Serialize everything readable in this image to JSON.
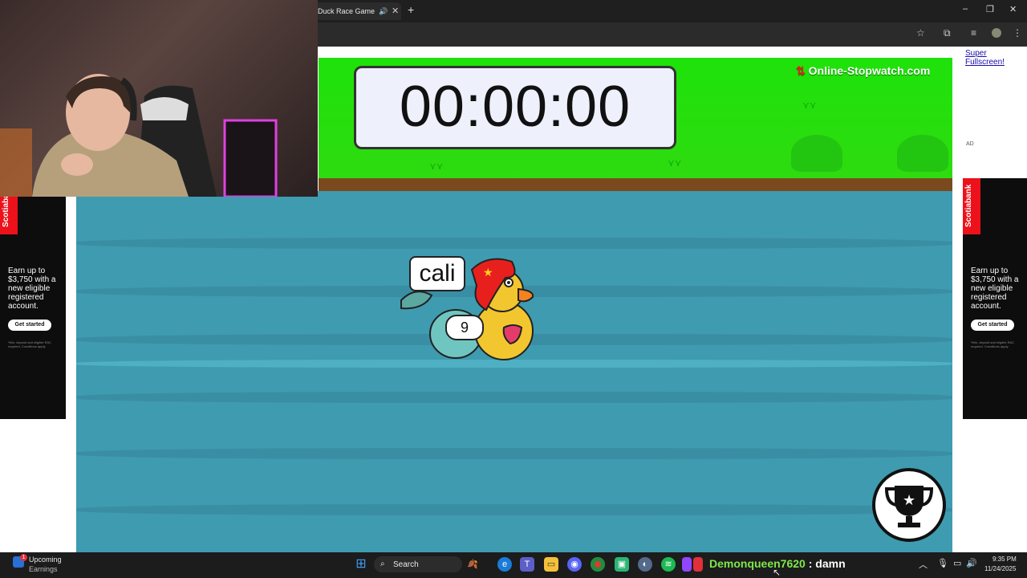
{
  "browser": {
    "tab_title": "Duck Race Game",
    "tab_sound_icon": "speaker-icon",
    "new_tab_symbol": "+",
    "window_controls": [
      "–",
      "❐",
      "✕"
    ]
  },
  "page": {
    "super_fullscreen_link": "Super Fullscreen!",
    "ad_label": "AD"
  },
  "game": {
    "timer": "00:00:00",
    "brand": "Online-Stopwatch.com",
    "duck_name": "cali",
    "duck_number": "9",
    "colors": {
      "grass": "#1ee20a",
      "water": "#3f9bb0",
      "dirt": "#7a4a1e"
    }
  },
  "ads": {
    "bank": "Scotiabank",
    "copy": "Earn up to $3,750 with a new eligible registered account.",
    "cta": "Get started",
    "fine_print": "*Min. deposit and eligible RAC required. Conditions apply."
  },
  "taskbar": {
    "widget_title": "Upcoming",
    "widget_subtitle": "Earnings",
    "widget_badge": "1",
    "search_label": "Search",
    "time": "9:35 PM",
    "date": "11/24/2025"
  },
  "chat": {
    "username": "Demonqueen7620",
    "separator": ":",
    "message": "damn"
  }
}
